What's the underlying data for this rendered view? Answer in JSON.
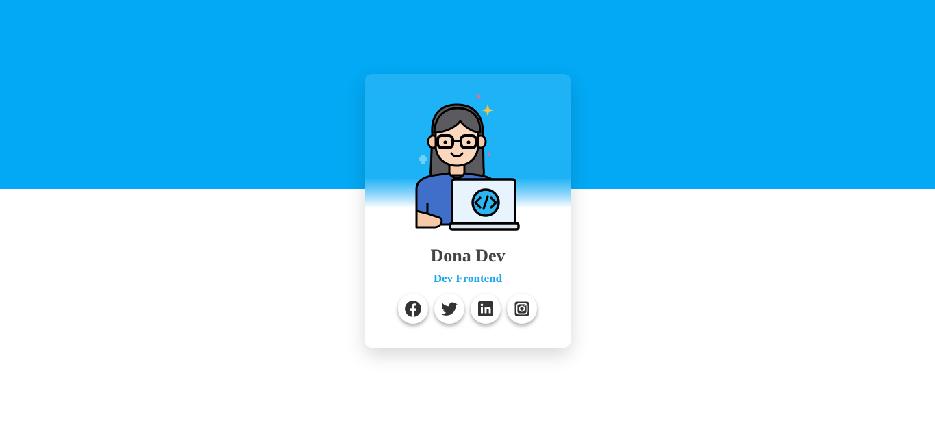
{
  "profile": {
    "name": "Dona Dev",
    "role": "Dev Frontend"
  },
  "socials": [
    {
      "name": "Facebook",
      "icon": "facebook-icon"
    },
    {
      "name": "Twitter",
      "icon": "twitter-icon"
    },
    {
      "name": "LinkedIn",
      "icon": "linkedin-icon"
    },
    {
      "name": "Instagram",
      "icon": "instagram-icon"
    }
  ],
  "colors": {
    "header_background": "#03a9f4",
    "accent": "#1ca7ec",
    "name_text": "#444444",
    "icon": "#333333"
  }
}
